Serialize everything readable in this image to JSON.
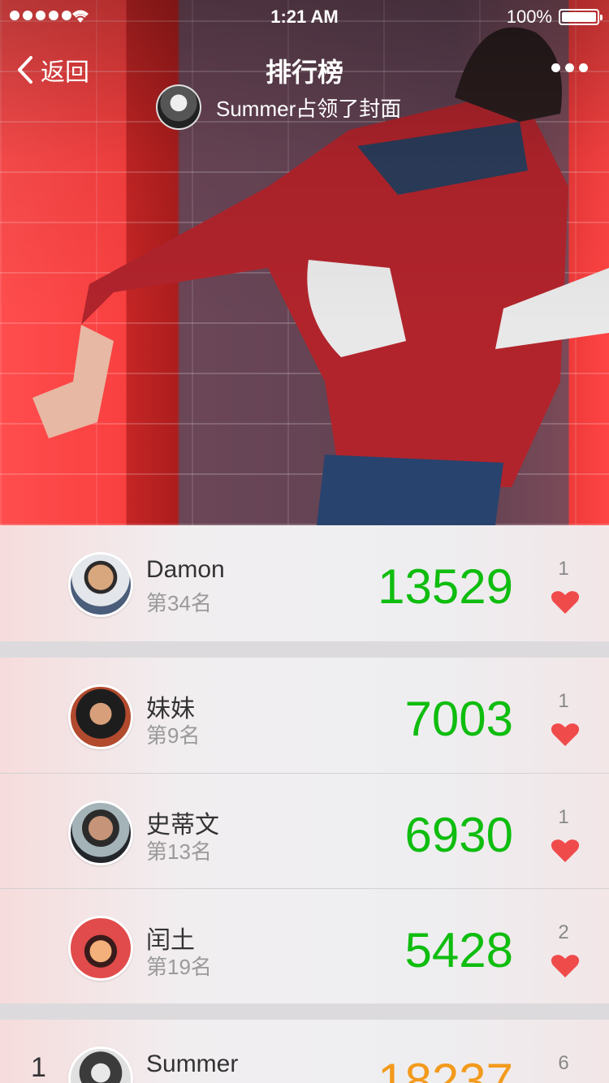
{
  "status_bar": {
    "time": "1:21 AM",
    "battery": "100%"
  },
  "nav": {
    "back_label": "返回",
    "title": "排行榜"
  },
  "cover": {
    "caption": "Summer占领了封面"
  },
  "colors": {
    "score_green": "#0fbd0f",
    "score_orange": "#f39a1c",
    "heart_red": "#f04b4b"
  },
  "leaders": [
    {
      "name": "Damon",
      "rank_text": "第34名",
      "score": "13529",
      "likes": "1"
    },
    {
      "name": "妹妹",
      "rank_text": "第9名",
      "score": "7003",
      "likes": "1"
    },
    {
      "name": "史蒂文",
      "rank_text": "第13名",
      "score": "6930",
      "likes": "1"
    },
    {
      "name": "闰土",
      "rank_text": "第19名",
      "score": "5428",
      "likes": "2"
    },
    {
      "rank": "1",
      "name": "Summer",
      "score": "18237",
      "likes": "6"
    }
  ]
}
